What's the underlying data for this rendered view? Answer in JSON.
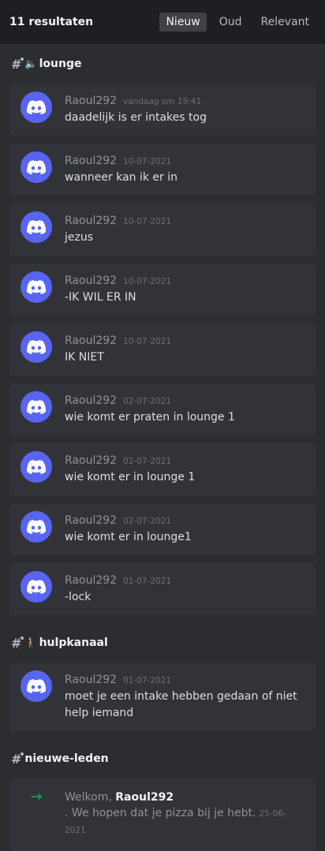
{
  "header": {
    "result_count": "11 resultaten",
    "tabs": [
      {
        "label": "Nieuw",
        "active": true
      },
      {
        "label": "Oud",
        "active": false
      },
      {
        "label": "Relevant",
        "active": false
      }
    ]
  },
  "groups": [
    {
      "channel_emoji": "🔈",
      "channel_name": "lounge",
      "messages": [
        {
          "author": "Raoul292",
          "time": "vandaag om 19:41",
          "text": "daadelijk is er intakes tog"
        },
        {
          "author": "Raoul292",
          "time": "10-07-2021",
          "text": "wanneer kan ik er in"
        },
        {
          "author": "Raoul292",
          "time": "10-07-2021",
          "text": "jezus"
        },
        {
          "author": "Raoul292",
          "time": "10-07-2021",
          "text": "-IK WIL ER IN"
        },
        {
          "author": "Raoul292",
          "time": "10-07-2021",
          "text": "IK NIET"
        },
        {
          "author": "Raoul292",
          "time": "02-07-2021",
          "text": "wie komt er praten in lounge 1"
        },
        {
          "author": "Raoul292",
          "time": "02-07-2021",
          "text": "wie komt er in lounge 1"
        },
        {
          "author": "Raoul292",
          "time": "02-07-2021",
          "text": "wie komt er in lounge1"
        },
        {
          "author": "Raoul292",
          "time": "01-07-2021",
          "text": "-lock"
        }
      ]
    },
    {
      "channel_emoji": "🚶",
      "channel_name": "hulpkanaal",
      "messages": [
        {
          "author": "Raoul292",
          "time": "01-07-2021",
          "text": "moet je een intake hebben gedaan of niet help iemand"
        }
      ]
    }
  ],
  "welcome_group": {
    "channel_name": "nieuwe-leden",
    "prefix": "Welkom, ",
    "user": "Raoul292",
    "suffix": ". We hopen dat je pizza bij je hebt.",
    "time": "25-06-2021"
  },
  "colors": {
    "accent": "#5865f2",
    "join_arrow": "#23a55a"
  },
  "icons": {
    "avatar": "discord-logo-icon",
    "join": "arrow-right-icon"
  }
}
